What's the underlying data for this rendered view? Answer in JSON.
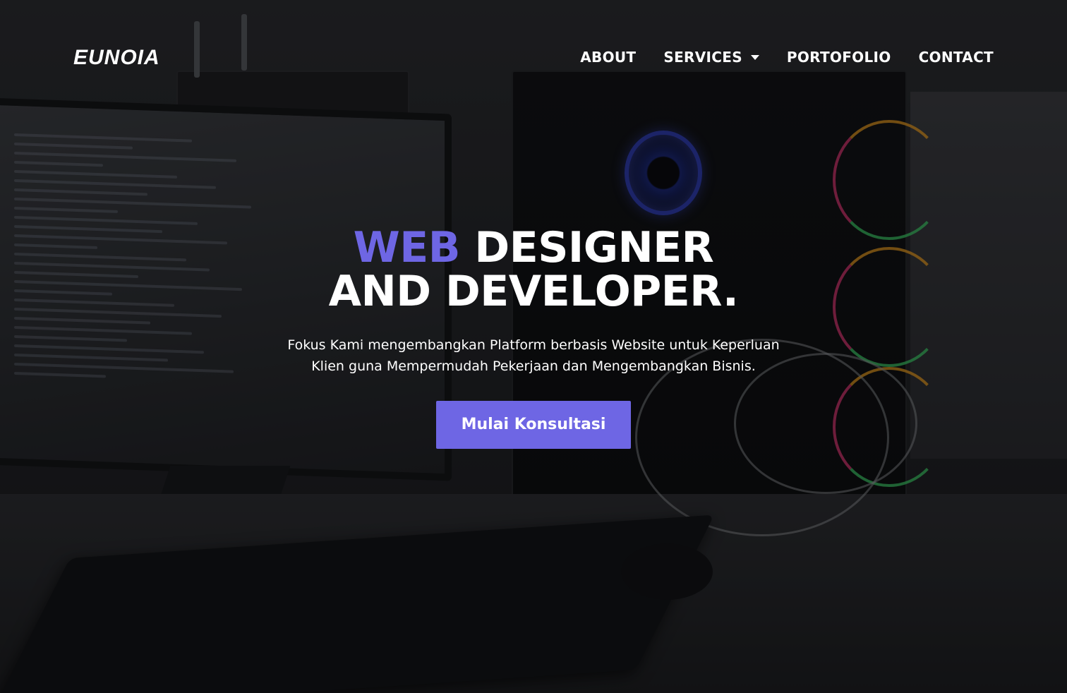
{
  "header": {
    "logo_text": "EUNOIA",
    "nav": [
      {
        "label": "ABOUT"
      },
      {
        "label": "SERVICES",
        "has_dropdown": true
      },
      {
        "label": "PORTOFOLIO"
      },
      {
        "label": "CONTACT"
      }
    ]
  },
  "hero": {
    "headline_accent": "WEB",
    "headline_rest": "DESIGNER",
    "headline_line2": "AND DEVELOPER.",
    "subtitle_line1": "Fokus Kami mengembangkan Platform berbasis Website untuk Keperluan",
    "subtitle_line2": "Klien guna Mempermudah Pekerjaan dan Mengembangkan Bisnis.",
    "cta_label": "Mulai Konsultasi"
  },
  "colors": {
    "accent": "#6e66e4",
    "text": "#ffffff",
    "overlay": "rgba(0,0,0,0.38)"
  },
  "icons": {
    "dropdown": "chevron-down-icon"
  }
}
